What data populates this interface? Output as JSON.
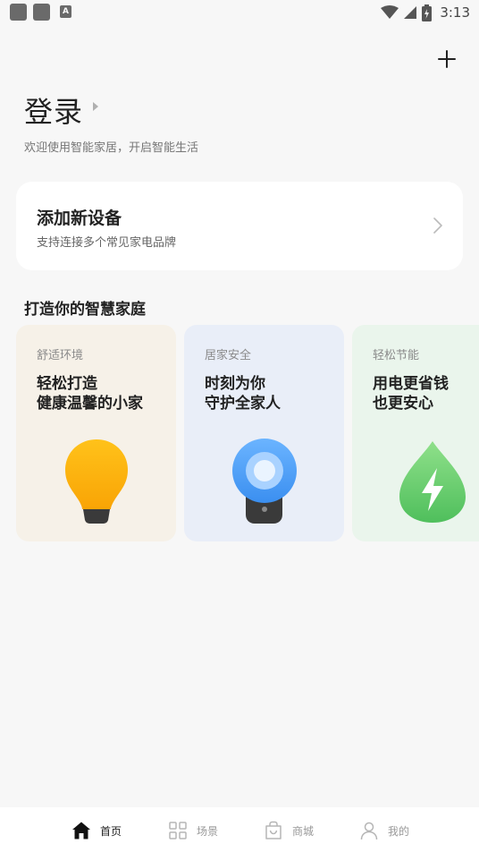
{
  "status_bar": {
    "time": "3:13",
    "notification_letter": "A"
  },
  "header": {
    "add_icon": "plus-icon"
  },
  "login": {
    "title": "登录",
    "subtitle": "欢迎使用智能家居，开启智能生活"
  },
  "add_device_card": {
    "title": "添加新设备",
    "subtitle": "支持连接多个常见家电品牌",
    "chevron_icon": "chevron-right-icon"
  },
  "section": {
    "title": "打造你的智慧家庭"
  },
  "feature_cards": [
    {
      "category": "舒适环境",
      "line1": "轻松打造",
      "line2": "健康温馨的小家",
      "bg": "#f6f1e8",
      "icon": "lightbulb-icon"
    },
    {
      "category": "居家安全",
      "line1": "时刻为你",
      "line2": "守护全家人",
      "bg": "#e9eef8",
      "icon": "security-camera-icon"
    },
    {
      "category": "轻松节能",
      "line1": "用电更省钱",
      "line2": "也更安心",
      "bg": "#eaf5ec",
      "icon": "energy-drop-icon"
    }
  ],
  "tabbar": {
    "tabs": [
      {
        "label": "首页",
        "icon": "home-icon",
        "active": true
      },
      {
        "label": "场景",
        "icon": "grid-icon",
        "active": false
      },
      {
        "label": "商城",
        "icon": "shopping-bag-icon",
        "active": false
      },
      {
        "label": "我的",
        "icon": "user-icon",
        "active": false
      }
    ]
  }
}
